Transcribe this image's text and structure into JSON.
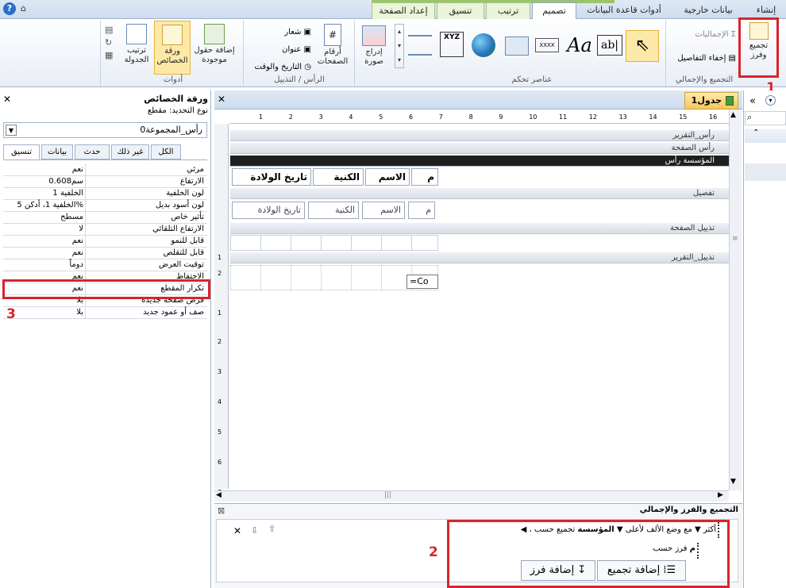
{
  "tabs": {
    "create": "إنشاء",
    "external": "بيانات خارجية",
    "dbtools": "أدوات قاعدة البيانات",
    "design": "تصميم",
    "arrange": "ترتيب",
    "format": "تنسيق",
    "pagesetup": "إعداد الصفحة"
  },
  "ribbon": {
    "group_sort": {
      "label": "التجميع والإجمالي",
      "group_sort_btn": "تجميع وفرز",
      "totals": "الإجماليات",
      "hide_details": "إخفاء التفاصيل"
    },
    "group_controls": {
      "label": "عناصر تحكم",
      "insert_image": "إدراج صورة",
      "xyz": "XYZ",
      "xxxx": "XXXX",
      "aa": "Aa",
      "ab": "ab|"
    },
    "group_header": {
      "label": "الرأس / التذييل",
      "page_numbers": "أرقام الصفحات",
      "logo": "شعار",
      "title": "عنوان",
      "datetime": "التاريخ والوقت"
    },
    "group_tools": {
      "label": "أدوات",
      "add_fields": "إضافة حقول موجودة",
      "property_sheet": "ورقة الخصائص",
      "tab_order": "ترتيب الجدولة"
    }
  },
  "annotations": {
    "n1": "1",
    "n2": "2",
    "n3": "3"
  },
  "property_sheet": {
    "title": "ورقة الخصائص",
    "selection_type": "نوع التحديد:  مقطع",
    "selected": "رأس_المجموعة0",
    "tabs": [
      "تنسيق",
      "بيانات",
      "حدث",
      "غير ذلك",
      "الكل"
    ],
    "rows": [
      {
        "n": "مرئي",
        "v": "نعم"
      },
      {
        "n": "الارتفاع",
        "v": "0.608سم"
      },
      {
        "n": "لون الخلفية",
        "v": "الخلفية 1"
      },
      {
        "n": "لون أسود بديل",
        "v": "الخلفية 1، أدكن 5%"
      },
      {
        "n": "تأثير خاص",
        "v": "مسطح"
      },
      {
        "n": "الارتفاع التلقائي",
        "v": "لا"
      },
      {
        "n": "قابل للنمو",
        "v": "نعم"
      },
      {
        "n": "قابل للتقلص",
        "v": "نعم"
      },
      {
        "n": "توقيت العرض",
        "v": "دوماً"
      },
      {
        "n": "الاحتفاظ",
        "v": "نعم"
      },
      {
        "n": "تكرار المقطع",
        "v": "نعم"
      },
      {
        "n": "فرض صفحة جديدة",
        "v": "بلا"
      },
      {
        "n": "صف أو عمود جديد",
        "v": "بلا"
      }
    ]
  },
  "document": {
    "tab": "جدول1"
  },
  "sections": {
    "report_header": "رأس_التقرير",
    "page_header": "رأس الصفحة",
    "group_header": "المؤسسة رأس",
    "detail": "تفصيل",
    "page_footer": "تذييل الصفحة",
    "report_footer": "تذييل_التقرير"
  },
  "columns": {
    "m": "م",
    "name": "الاسم",
    "nick": "الكنية",
    "dob": "تاريخ الولادة"
  },
  "textboxes": {
    "m": "م",
    "name": "الاسم",
    "nick": "الكنية",
    "dob": "تاريخ الولادة"
  },
  "footer_cell": "=Co",
  "group_pane": {
    "title": "التجميع والفرز والإجمالي",
    "group_line": "تجميع حسب",
    "group_field": "المؤسسة",
    "order": "مع وضع الألف لأعلى",
    "more": "، أكثر",
    "sort_line": "فرز حسب",
    "sort_field": "م",
    "add_group": "إضافة تجميع",
    "add_sort": "إضافة فرز"
  },
  "ruler": [
    "1",
    "2",
    "3",
    "4",
    "5",
    "6",
    "7",
    "8",
    "9",
    "10",
    "11",
    "12",
    "13",
    "14",
    "15",
    "16"
  ],
  "vruler": [
    "1",
    "2",
    "1",
    "2",
    "3",
    "4",
    "5",
    "6",
    "7"
  ]
}
